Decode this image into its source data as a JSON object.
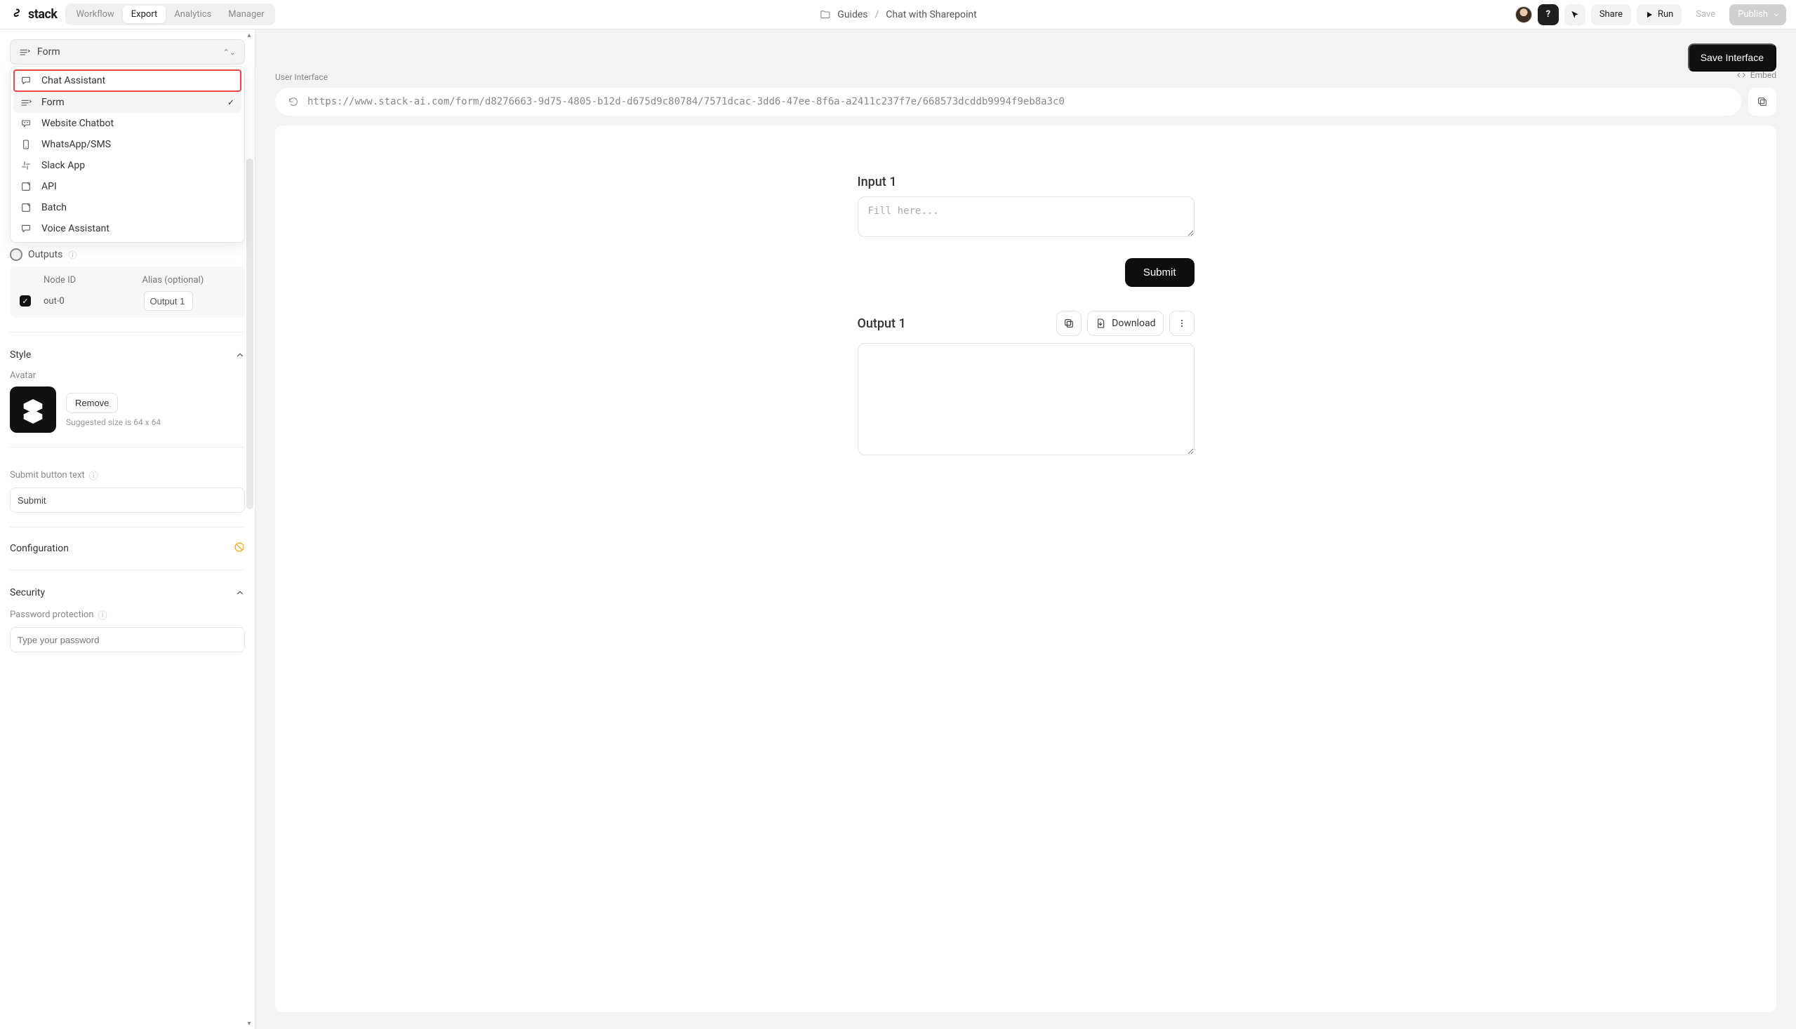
{
  "brand": {
    "name": "stack"
  },
  "tabs": {
    "items": [
      "Workflow",
      "Export",
      "Analytics",
      "Manager"
    ],
    "active": "Export"
  },
  "breadcrumbs": {
    "folder": "Guides",
    "page": "Chat with Sharepoint"
  },
  "topbar": {
    "share": "Share",
    "run": "Run",
    "save": "Save",
    "publish": "Publish"
  },
  "sidebar": {
    "selector": {
      "selected": "Form"
    },
    "dropdown": [
      {
        "label": "Chat Assistant",
        "icon": "chat-icon",
        "highlight": true
      },
      {
        "label": "Form",
        "icon": "form-icon",
        "selected": true,
        "hovered": true
      },
      {
        "label": "Website Chatbot",
        "icon": "chatbot-icon"
      },
      {
        "label": "WhatsApp/SMS",
        "icon": "phone-icon"
      },
      {
        "label": "Slack App",
        "icon": "slack-icon"
      },
      {
        "label": "API",
        "icon": "api-icon"
      },
      {
        "label": "Batch",
        "icon": "batch-icon"
      },
      {
        "label": "Voice Assistant",
        "icon": "voice-icon"
      }
    ],
    "outputs": {
      "title": "Outputs",
      "columns": {
        "id": "Node ID",
        "alias": "Alias (optional)"
      },
      "rows": [
        {
          "checked": true,
          "node": "out-0",
          "alias": "Output 1"
        }
      ]
    },
    "style": {
      "title": "Style",
      "avatar_label": "Avatar",
      "remove": "Remove",
      "avatar_hint": "Suggested size is 64 x 64",
      "submit_text_label": "Submit button text",
      "submit_text_value": "Submit"
    },
    "configuration": {
      "title": "Configuration"
    },
    "security": {
      "title": "Security",
      "password_label": "Password protection",
      "password_placeholder": "Type your password"
    }
  },
  "main": {
    "save_interface": "Save Interface",
    "ui_label": "User Interface",
    "embed": "Embed",
    "url": "https://www.stack-ai.com/form/d8276663-9d75-4805-b12d-d675d9c80784/7571dcac-3dd6-47ee-8f6a-a2411c237f7e/668573dcddb9994f9eb8a3c0",
    "input_label": "Input 1",
    "input_placeholder": "Fill here...",
    "submit": "Submit",
    "output_label": "Output 1",
    "download": "Download"
  }
}
